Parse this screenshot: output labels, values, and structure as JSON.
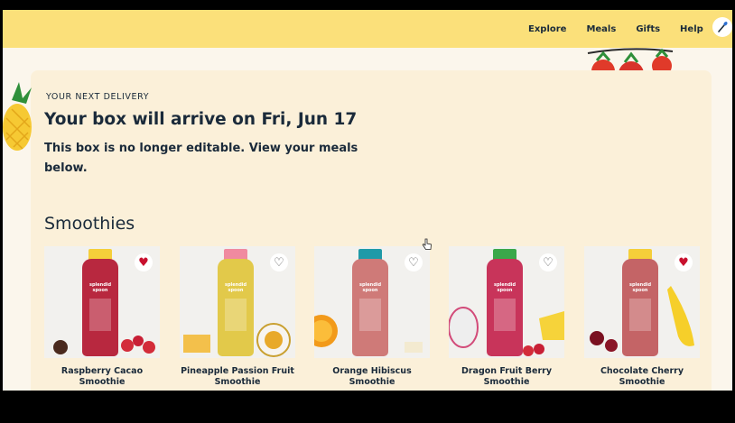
{
  "nav": {
    "items": [
      "Explore",
      "Meals",
      "Gifts",
      "Help"
    ]
  },
  "delivery": {
    "eyebrow": "YOUR NEXT DELIVERY",
    "headline": "Your box will arrive on Fri, Jun 17",
    "subtext": "This box is no longer editable. View your meals below."
  },
  "section": {
    "title": "Smoothies"
  },
  "products": [
    {
      "name": "Raspberry Cacao Smoothie",
      "favorited": true,
      "heart_icon": "heart-filled-icon",
      "bottle_color": "#b8283f",
      "cap_color": "#f5cf3a"
    },
    {
      "name": "Pineapple Passion Fruit Smoothie",
      "favorited": false,
      "heart_icon": "heart-outline-icon",
      "bottle_color": "#e2c94a",
      "cap_color": "#f08aa0"
    },
    {
      "name": "Orange Hibiscus Smoothie",
      "favorited": false,
      "heart_icon": "heart-outline-icon",
      "bottle_color": "#cf7a78",
      "cap_color": "#1f9aa8"
    },
    {
      "name": "Dragon Fruit Berry Smoothie",
      "favorited": false,
      "heart_icon": "heart-outline-icon",
      "bottle_color": "#c8345a",
      "cap_color": "#3aa84a"
    },
    {
      "name": "Chocolate Cherry Smoothie",
      "favorited": true,
      "heart_icon": "heart-filled-icon",
      "bottle_color": "#c46466",
      "cap_color": "#f5cf3a"
    }
  ],
  "colors": {
    "topbar": "#fbe07a",
    "card": "#fbf0d9",
    "text": "#1a2a3a",
    "heart_active": "#c8102e"
  }
}
